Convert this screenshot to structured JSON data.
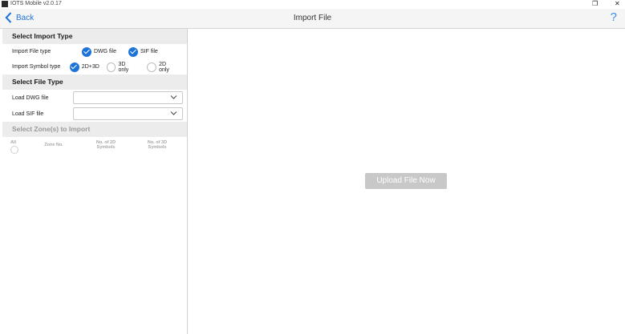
{
  "window": {
    "title": "IOTS Mobile v2.0.17"
  },
  "nav": {
    "back_label": "Back",
    "title": "Import File",
    "help_label": "?"
  },
  "select_import_type": {
    "heading": "Select Import Type",
    "file_type": {
      "label": "Import File type",
      "options": [
        "DWG file",
        "SIF file"
      ]
    },
    "symbol_type": {
      "label": "Import Symbol type",
      "options": [
        "2D+3D",
        "3D only",
        "2D only"
      ],
      "selected": "2D+3D"
    }
  },
  "select_file_type": {
    "heading": "Select File Type",
    "dwg": {
      "label": "Load DWG file",
      "value": ""
    },
    "sif": {
      "label": "Load SIF file",
      "value": ""
    }
  },
  "zones": {
    "heading": "Select Zone(s) to Import",
    "columns": {
      "all": "All",
      "zone_no": "Zone No.",
      "no_2d": "No. of 2D Symbols",
      "no_3d": "No. of 3D Symbols"
    }
  },
  "main": {
    "upload_label": "Upload File Now"
  },
  "colors": {
    "accent": "#1e73d8",
    "section_bg": "#ececec",
    "disabled_button": "#c8c8c8"
  }
}
